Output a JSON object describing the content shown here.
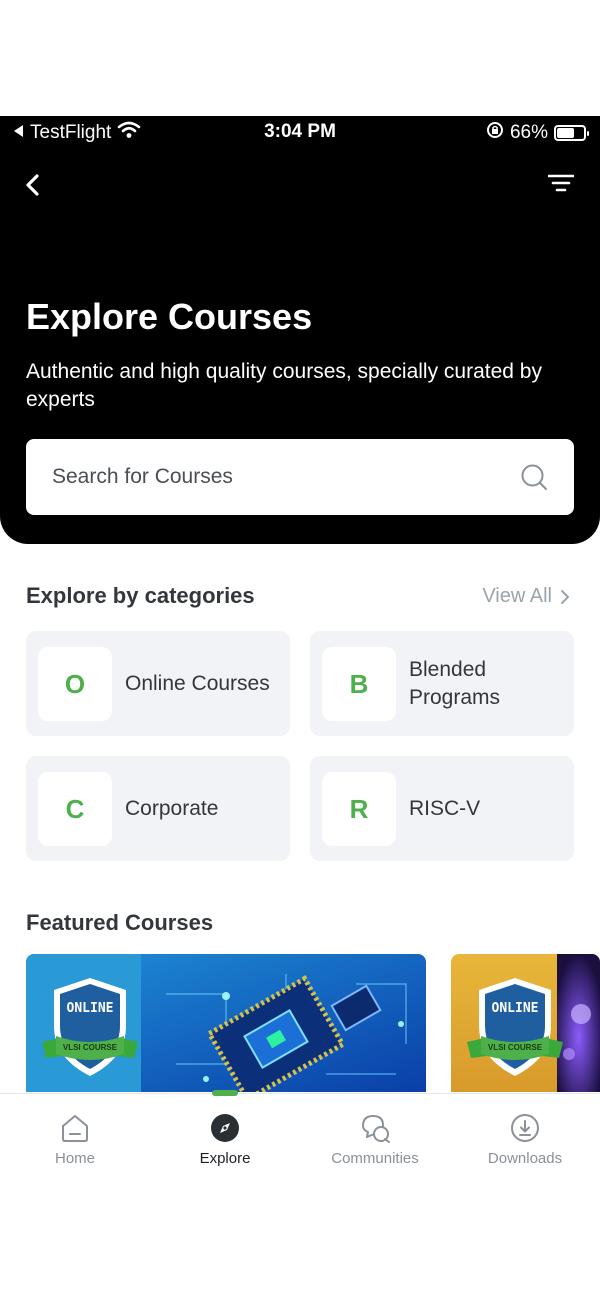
{
  "status_bar": {
    "carrier": "TestFlight",
    "time": "3:04 PM",
    "battery_percent": "66%",
    "battery_level": 0.66
  },
  "hero": {
    "title": "Explore Courses",
    "subtitle": "Authentic and high quality courses, specially curated by experts",
    "search_placeholder": "Search for Courses"
  },
  "categories": {
    "title": "Explore by categories",
    "view_all": "View All",
    "items": [
      {
        "initial": "O",
        "label": "Online Courses"
      },
      {
        "initial": "B",
        "label": "Blended Programs"
      },
      {
        "initial": "C",
        "label": "Corporate"
      },
      {
        "initial": "R",
        "label": "RISC-V"
      }
    ]
  },
  "featured": {
    "title": "Featured Courses",
    "cards": [
      {
        "badge_top": "ONLINE",
        "badge_ribbon": "VLSI COURSE"
      },
      {
        "badge_top": "ONLINE",
        "badge_ribbon": "VLSI COURSE"
      }
    ]
  },
  "tabs": [
    {
      "label": "Home",
      "icon": "home-icon",
      "active": false
    },
    {
      "label": "Explore",
      "icon": "compass-icon",
      "active": true
    },
    {
      "label": "Communities",
      "icon": "chat-icon",
      "active": false
    },
    {
      "label": "Downloads",
      "icon": "download-icon",
      "active": false
    }
  ],
  "colors": {
    "accent": "#4db04a",
    "hero_bg": "#000000",
    "card_bg": "#f1f3f6"
  }
}
